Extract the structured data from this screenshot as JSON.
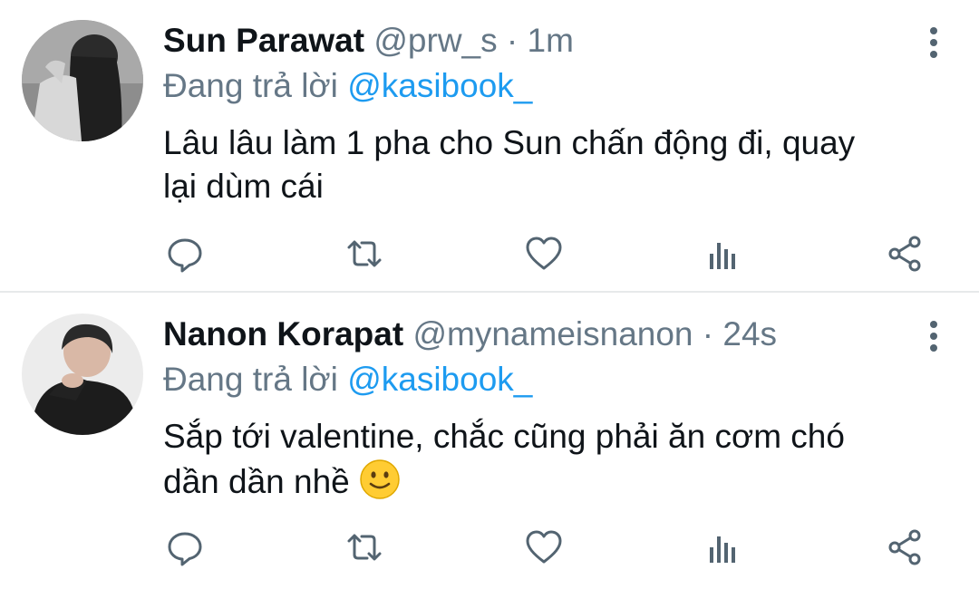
{
  "tweets": [
    {
      "name": "Sun Parawat",
      "handle": "@prw_s",
      "separator": "·",
      "time": "1m",
      "reply_prefix": "Đang trả lời",
      "reply_mention": "@kasibook_",
      "body_line1": "Lâu lâu làm 1 pha cho Sun chấn động đi, quay",
      "body_line2": "lại dùm cái",
      "avatar_icon": "avatar-photo",
      "actions": [
        "reply-icon",
        "retweet-icon",
        "like-icon",
        "analytics-icon",
        "share-icon"
      ]
    },
    {
      "name": "Nanon Korapat",
      "handle": "@mynameisnanon",
      "separator": "·",
      "time": "24s",
      "reply_prefix": "Đang trả lời",
      "reply_mention": "@kasibook_",
      "body_line1": "Sắp tới valentine, chắc cũng phải ăn cơm chó",
      "body_line2": "dần dần nhề",
      "body_emoji": "slightly-smiling-face",
      "avatar_icon": "avatar-photo",
      "actions": [
        "reply-icon",
        "retweet-icon",
        "like-icon",
        "analytics-icon",
        "share-icon"
      ]
    }
  ],
  "colors": {
    "text": "#0f1419",
    "muted": "#657786",
    "link": "#1d9bf0",
    "divider": "#e7e9ea"
  }
}
